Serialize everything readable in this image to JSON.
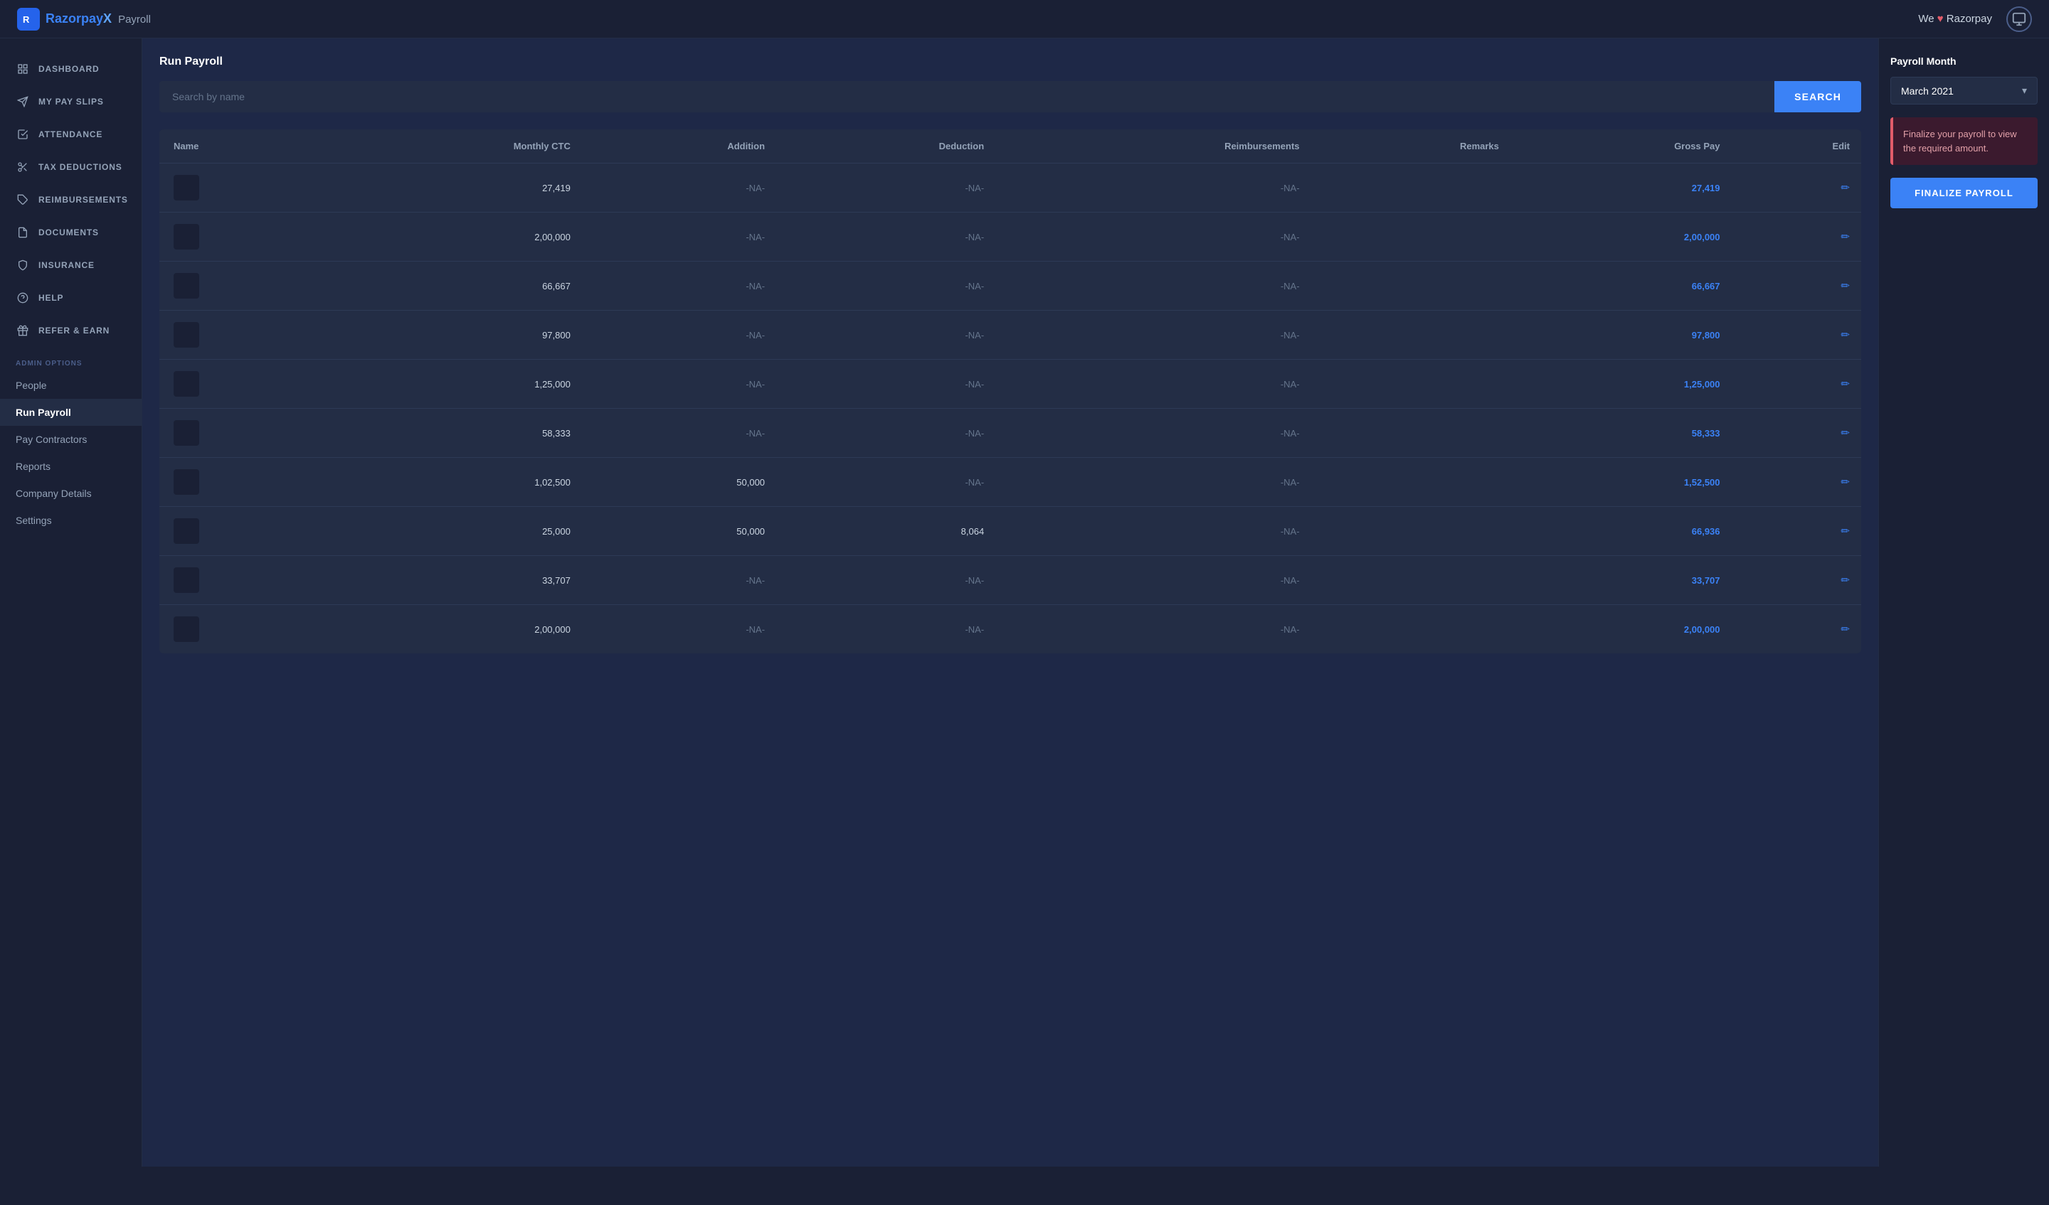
{
  "app": {
    "logo_text": "RazorpayX",
    "logo_sub": "Payroll",
    "topnav_love": "We ♥ Razorpay"
  },
  "sidebar": {
    "section_label": "ADMIN OPTIONS",
    "items": [
      {
        "id": "dashboard",
        "label": "DASHBOARD",
        "icon": "grid-icon"
      },
      {
        "id": "my-pay-slips",
        "label": "MY PAY SLIPS",
        "icon": "send-icon"
      },
      {
        "id": "attendance",
        "label": "ATTENDANCE",
        "icon": "check-square-icon"
      },
      {
        "id": "tax-deductions",
        "label": "TAX DEDUCTIONS",
        "icon": "scissors-icon"
      },
      {
        "id": "reimbursements",
        "label": "REIMBURSEMENTS",
        "icon": "tag-icon"
      },
      {
        "id": "documents",
        "label": "DOCUMENTS",
        "icon": "file-icon"
      },
      {
        "id": "insurance",
        "label": "INSURANCE",
        "icon": "shield-icon"
      },
      {
        "id": "help",
        "label": "HELP",
        "icon": "help-icon"
      },
      {
        "id": "refer-earn",
        "label": "REFER & EARN",
        "icon": "refer-icon"
      }
    ],
    "admin_items": [
      {
        "id": "people",
        "label": "People",
        "active": false
      },
      {
        "id": "run-payroll",
        "label": "Run Payroll",
        "active": true
      },
      {
        "id": "pay-contractors",
        "label": "Pay Contractors",
        "active": false
      },
      {
        "id": "reports",
        "label": "Reports",
        "active": false
      },
      {
        "id": "company-details",
        "label": "Company Details",
        "active": false
      },
      {
        "id": "settings",
        "label": "Settings",
        "active": false
      }
    ]
  },
  "page": {
    "title": "Run Payroll",
    "search_placeholder": "Search by name",
    "search_button": "SEARCH"
  },
  "table": {
    "columns": [
      "Name",
      "Monthly CTC",
      "Addition",
      "Deduction",
      "Reimbursements",
      "Remarks",
      "Gross Pay",
      "Edit"
    ],
    "rows": [
      {
        "name": "",
        "monthly_ctc": "27,419",
        "addition": "-NA-",
        "deduction": "-NA-",
        "reimbursements": "-NA-",
        "remarks": "",
        "gross_pay": "27,419"
      },
      {
        "name": "",
        "monthly_ctc": "2,00,000",
        "addition": "-NA-",
        "deduction": "-NA-",
        "reimbursements": "-NA-",
        "remarks": "",
        "gross_pay": "2,00,000"
      },
      {
        "name": "",
        "monthly_ctc": "66,667",
        "addition": "-NA-",
        "deduction": "-NA-",
        "reimbursements": "-NA-",
        "remarks": "",
        "gross_pay": "66,667"
      },
      {
        "name": "",
        "monthly_ctc": "97,800",
        "addition": "-NA-",
        "deduction": "-NA-",
        "reimbursements": "-NA-",
        "remarks": "",
        "gross_pay": "97,800"
      },
      {
        "name": "",
        "monthly_ctc": "1,25,000",
        "addition": "-NA-",
        "deduction": "-NA-",
        "reimbursements": "-NA-",
        "remarks": "",
        "gross_pay": "1,25,000"
      },
      {
        "name": "",
        "monthly_ctc": "58,333",
        "addition": "-NA-",
        "deduction": "-NA-",
        "reimbursements": "-NA-",
        "remarks": "",
        "gross_pay": "58,333"
      },
      {
        "name": "",
        "monthly_ctc": "1,02,500",
        "addition": "50,000",
        "deduction": "-NA-",
        "reimbursements": "-NA-",
        "remarks": "",
        "gross_pay": "1,52,500"
      },
      {
        "name": "",
        "monthly_ctc": "25,000",
        "addition": "50,000",
        "deduction": "8,064",
        "reimbursements": "-NA-",
        "remarks": "",
        "gross_pay": "66,936"
      },
      {
        "name": "",
        "monthly_ctc": "33,707",
        "addition": "-NA-",
        "deduction": "-NA-",
        "reimbursements": "-NA-",
        "remarks": "",
        "gross_pay": "33,707"
      },
      {
        "name": "",
        "monthly_ctc": "2,00,000",
        "addition": "-NA-",
        "deduction": "-NA-",
        "reimbursements": "-NA-",
        "remarks": "",
        "gross_pay": "2,00,000"
      }
    ]
  },
  "right_panel": {
    "title": "Payroll Month",
    "month": "March 2021",
    "notice": "Finalize your payroll to view the required amount.",
    "finalize_button": "FINALIZE PAYROLL"
  }
}
